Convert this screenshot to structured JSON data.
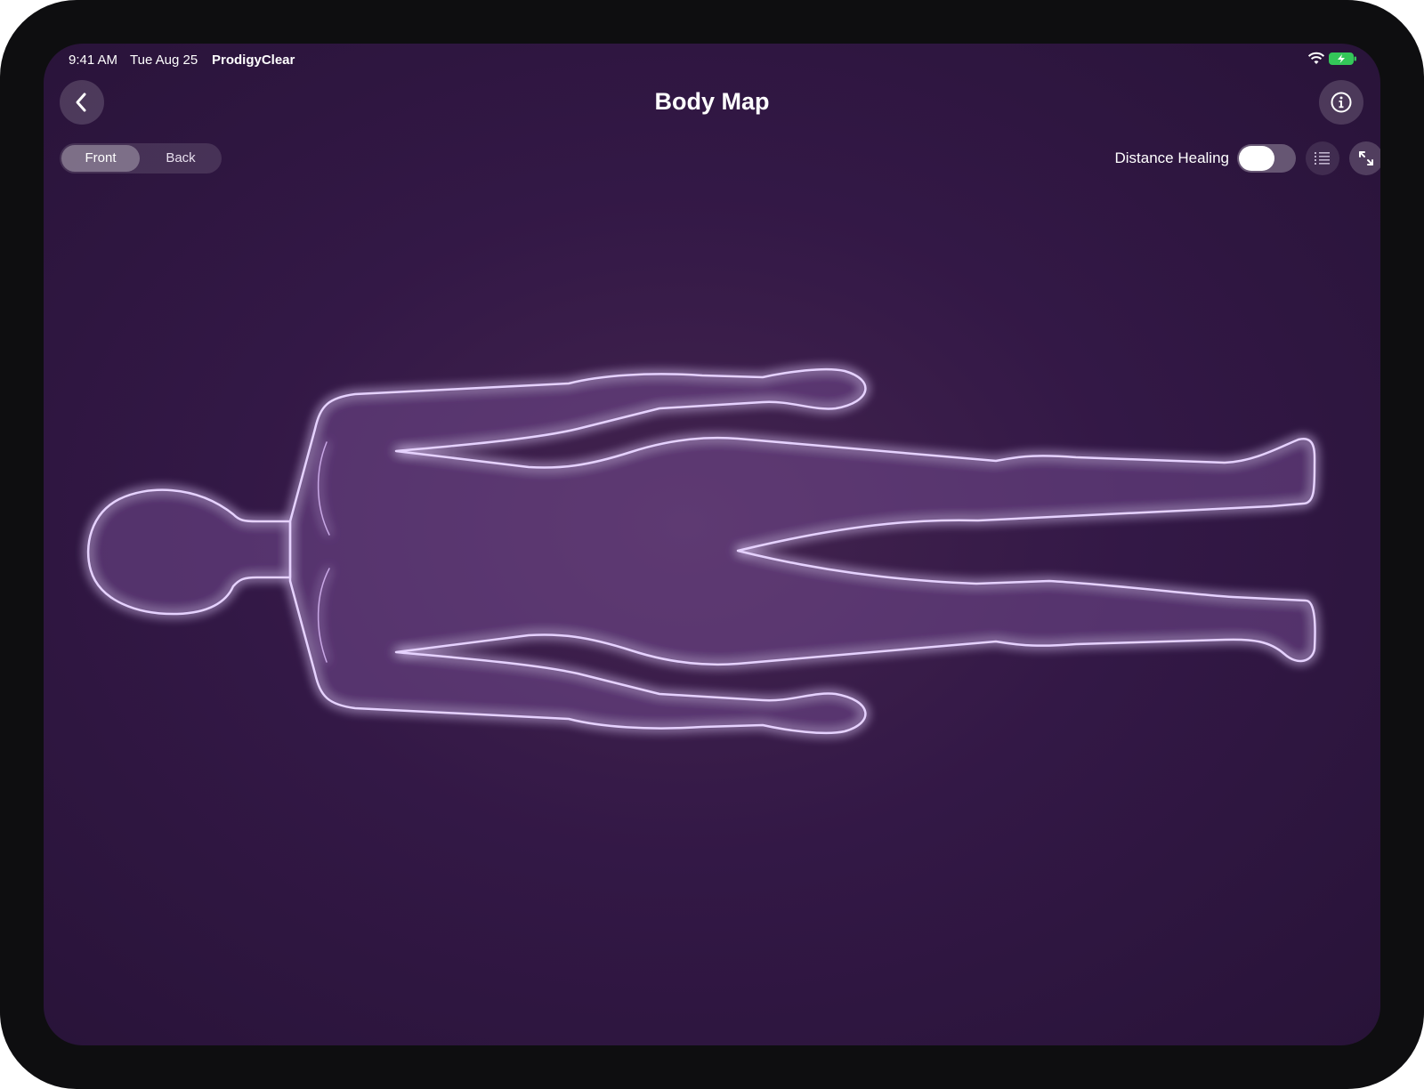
{
  "status": {
    "time": "9:41 AM",
    "date": "Tue Aug 25",
    "app": "ProdigyClear"
  },
  "nav": {
    "title": "Body Map",
    "back_icon": "chevron-left-icon",
    "info_icon": "info-circle-icon"
  },
  "view_toggle": {
    "options": [
      "Front",
      "Back"
    ],
    "selected": "Front"
  },
  "distance_healing": {
    "label": "Distance Healing",
    "enabled": false
  },
  "toolbar": {
    "list_icon": "list-icon",
    "expand_icon": "expand-arrows-icon"
  },
  "colors": {
    "background": "#331846",
    "outline": "#e6d2ff",
    "glow": "#b06cff"
  }
}
